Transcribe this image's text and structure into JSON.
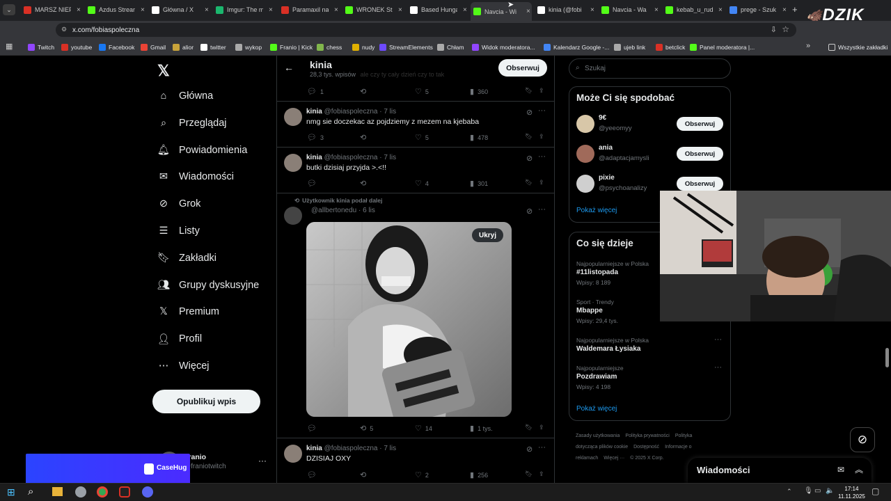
{
  "browser": {
    "tabs": [
      {
        "title": "MARSZ NIEPODLEGŁOŚCI",
        "color": "#d93025",
        "icon": "youtube-icon"
      },
      {
        "title": "Azdus Stream",
        "color": "#53fc18",
        "icon": "kick-icon"
      },
      {
        "title": "Główna / X",
        "color": "#ffffff",
        "icon": "x-icon"
      },
      {
        "title": "Imgur: The magic",
        "color": "#1bb76e",
        "icon": "imgur-icon"
      },
      {
        "title": "Paramaxil na",
        "color": "#d93025",
        "icon": "youtube-icon"
      },
      {
        "title": "WRONEK Stream",
        "color": "#53fc18",
        "icon": "kick-icon"
      },
      {
        "title": "Based Hungary",
        "color": "#ffffff",
        "icon": "x-icon"
      },
      {
        "title": "Navcia - Wi",
        "color": "#53fc18",
        "icon": "kick-icon"
      },
      {
        "title": "kinia (@fobi",
        "color": "#ffffff",
        "icon": "x-icon"
      },
      {
        "title": "Navcia - Wa",
        "color": "#53fc18",
        "icon": "kick-icon"
      },
      {
        "title": "kebab_u_rud",
        "color": "#53fc18",
        "icon": "kick-icon"
      },
      {
        "title": "prege - Szuk",
        "color": "#4285f4",
        "icon": "google-icon"
      }
    ],
    "url": "x.com/fobiaspoleczna",
    "bookmarks": [
      {
        "label": "Twitch",
        "color": "#9146ff"
      },
      {
        "label": "youtube",
        "color": "#d93025"
      },
      {
        "label": "Facebook",
        "color": "#1877f2"
      },
      {
        "label": "Gmail",
        "color": "#ea4335"
      },
      {
        "label": "alior",
        "color": "#c8a33a"
      },
      {
        "label": "twitter",
        "color": "#ffffff"
      },
      {
        "label": "wykop",
        "color": "#aaaaaa"
      },
      {
        "label": "Franio | Kick",
        "color": "#53fc18"
      },
      {
        "label": "chess",
        "color": "#81b64c"
      },
      {
        "label": "nudy",
        "color": "#e0b000"
      },
      {
        "label": "StreamElements",
        "color": "#6d4aff"
      },
      {
        "label": "Chłam",
        "color": "#aaaaaa"
      },
      {
        "label": "Widok moderatora...",
        "color": "#9146ff"
      },
      {
        "label": "Kalendarz Google -...",
        "color": "#4285f4"
      },
      {
        "label": "ujeb link",
        "color": "#aaaaaa"
      },
      {
        "label": "betclick",
        "color": "#d93025"
      },
      {
        "label": "Panel moderatora |...",
        "color": "#53fc18"
      }
    ],
    "all_bookmarks": "Wszystkie zakładki"
  },
  "sidebar": {
    "items": [
      {
        "label": "Główna",
        "icon": "home-icon"
      },
      {
        "label": "Przeglądaj",
        "icon": "search-icon"
      },
      {
        "label": "Powiadomienia",
        "icon": "bell-icon"
      },
      {
        "label": "Wiadomości",
        "icon": "mail-icon"
      },
      {
        "label": "Grok",
        "icon": "grok-icon"
      },
      {
        "label": "Listy",
        "icon": "list-icon"
      },
      {
        "label": "Zakładki",
        "icon": "bookmark-icon"
      },
      {
        "label": "Grupy dyskusyjne",
        "icon": "people-icon"
      },
      {
        "label": "Premium",
        "icon": "x-icon"
      },
      {
        "label": "Profil",
        "icon": "person-icon"
      },
      {
        "label": "Więcej",
        "icon": "more-icon"
      }
    ],
    "post_button": "Opublikuj wpis",
    "account_name": "Franio",
    "account_handle": "@franiotwitch"
  },
  "header": {
    "name": "kinia",
    "posts_count": "28,3 tys. wpisów",
    "follow": "Obserwuj",
    "partial_text": "ale czy ty cały dzień czy to tak"
  },
  "tweets": [
    {
      "stats": {
        "replies": "1",
        "reposts": "",
        "likes": "5",
        "views": "360"
      }
    },
    {
      "name": "kinia",
      "handle": "@fobiaspoleczna",
      "time": "· 7 lis",
      "text": "nmg sie doczekac az pojdziemy z mezem na kjebaba",
      "stats": {
        "replies": "3",
        "reposts": "",
        "likes": "5",
        "views": "478"
      }
    },
    {
      "name": "kinia",
      "handle": "@fobiaspoleczna",
      "time": "· 7 lis",
      "text": "butki dzisiaj przyjda >.<!!",
      "stats": {
        "replies": "",
        "reposts": "",
        "likes": "4",
        "views": "301"
      }
    },
    {
      "repost_note": "Użytkownik kinia podał dalej",
      "handle": "@allbertonedu",
      "time": "· 6 lis",
      "hide": "Ukryj",
      "stats": {
        "replies": "",
        "reposts": "5",
        "likes": "14",
        "views": "1 tys."
      }
    },
    {
      "name": "kinia",
      "handle": "@fobiaspoleczna",
      "time": "· 7 lis",
      "text": "DZISIAJ OXY",
      "stats": {
        "replies": "",
        "reposts": "",
        "likes": "2",
        "views": "256"
      }
    }
  ],
  "right": {
    "search_placeholder": "Szukaj",
    "suggest_title": "Może Ci się spodobać",
    "suggestions": [
      {
        "name": "9€",
        "handle": "@yeeomyy",
        "button": "Obserwuj"
      },
      {
        "name": "ania",
        "handle": "@adaptacjamysli",
        "button": "Obserwuj"
      },
      {
        "name": "pixie",
        "handle": "@psychoanalizy",
        "button": "Obserwuj"
      }
    ],
    "show_more": "Pokaż więcej",
    "trends_title": "Co się dzieje",
    "trends": [
      {
        "context": "Najpopularniejsze w Polska",
        "name": "#11listopada",
        "count": "Wpisy: 8 189"
      },
      {
        "context": "Sport · Trendy",
        "name": "Mbappe",
        "count": "Wpisy: 29,4 tys."
      },
      {
        "context": "Najpopularniejsze w Polska",
        "name": "Waldemara Łysiaka",
        "count": ""
      },
      {
        "context": "Najpopularniejsze",
        "name": "Pozdrawiam",
        "count": "Wpisy: 4 198"
      }
    ],
    "trends_more": "Pokaż więcej",
    "footer": [
      "Zasady użytkowania",
      "Polityka prywatności",
      "Polityka dotycząca plików cookie",
      "Dostępność",
      "Informacje o reklamach",
      "Więcej ···",
      "© 2025 X Corp."
    ],
    "messages": "Wiadomości"
  },
  "overlay": {
    "brand": "DZIK",
    "sponsor": "CaseHug"
  },
  "taskbar": {
    "time": "17:14",
    "date": "11.11.2025"
  }
}
